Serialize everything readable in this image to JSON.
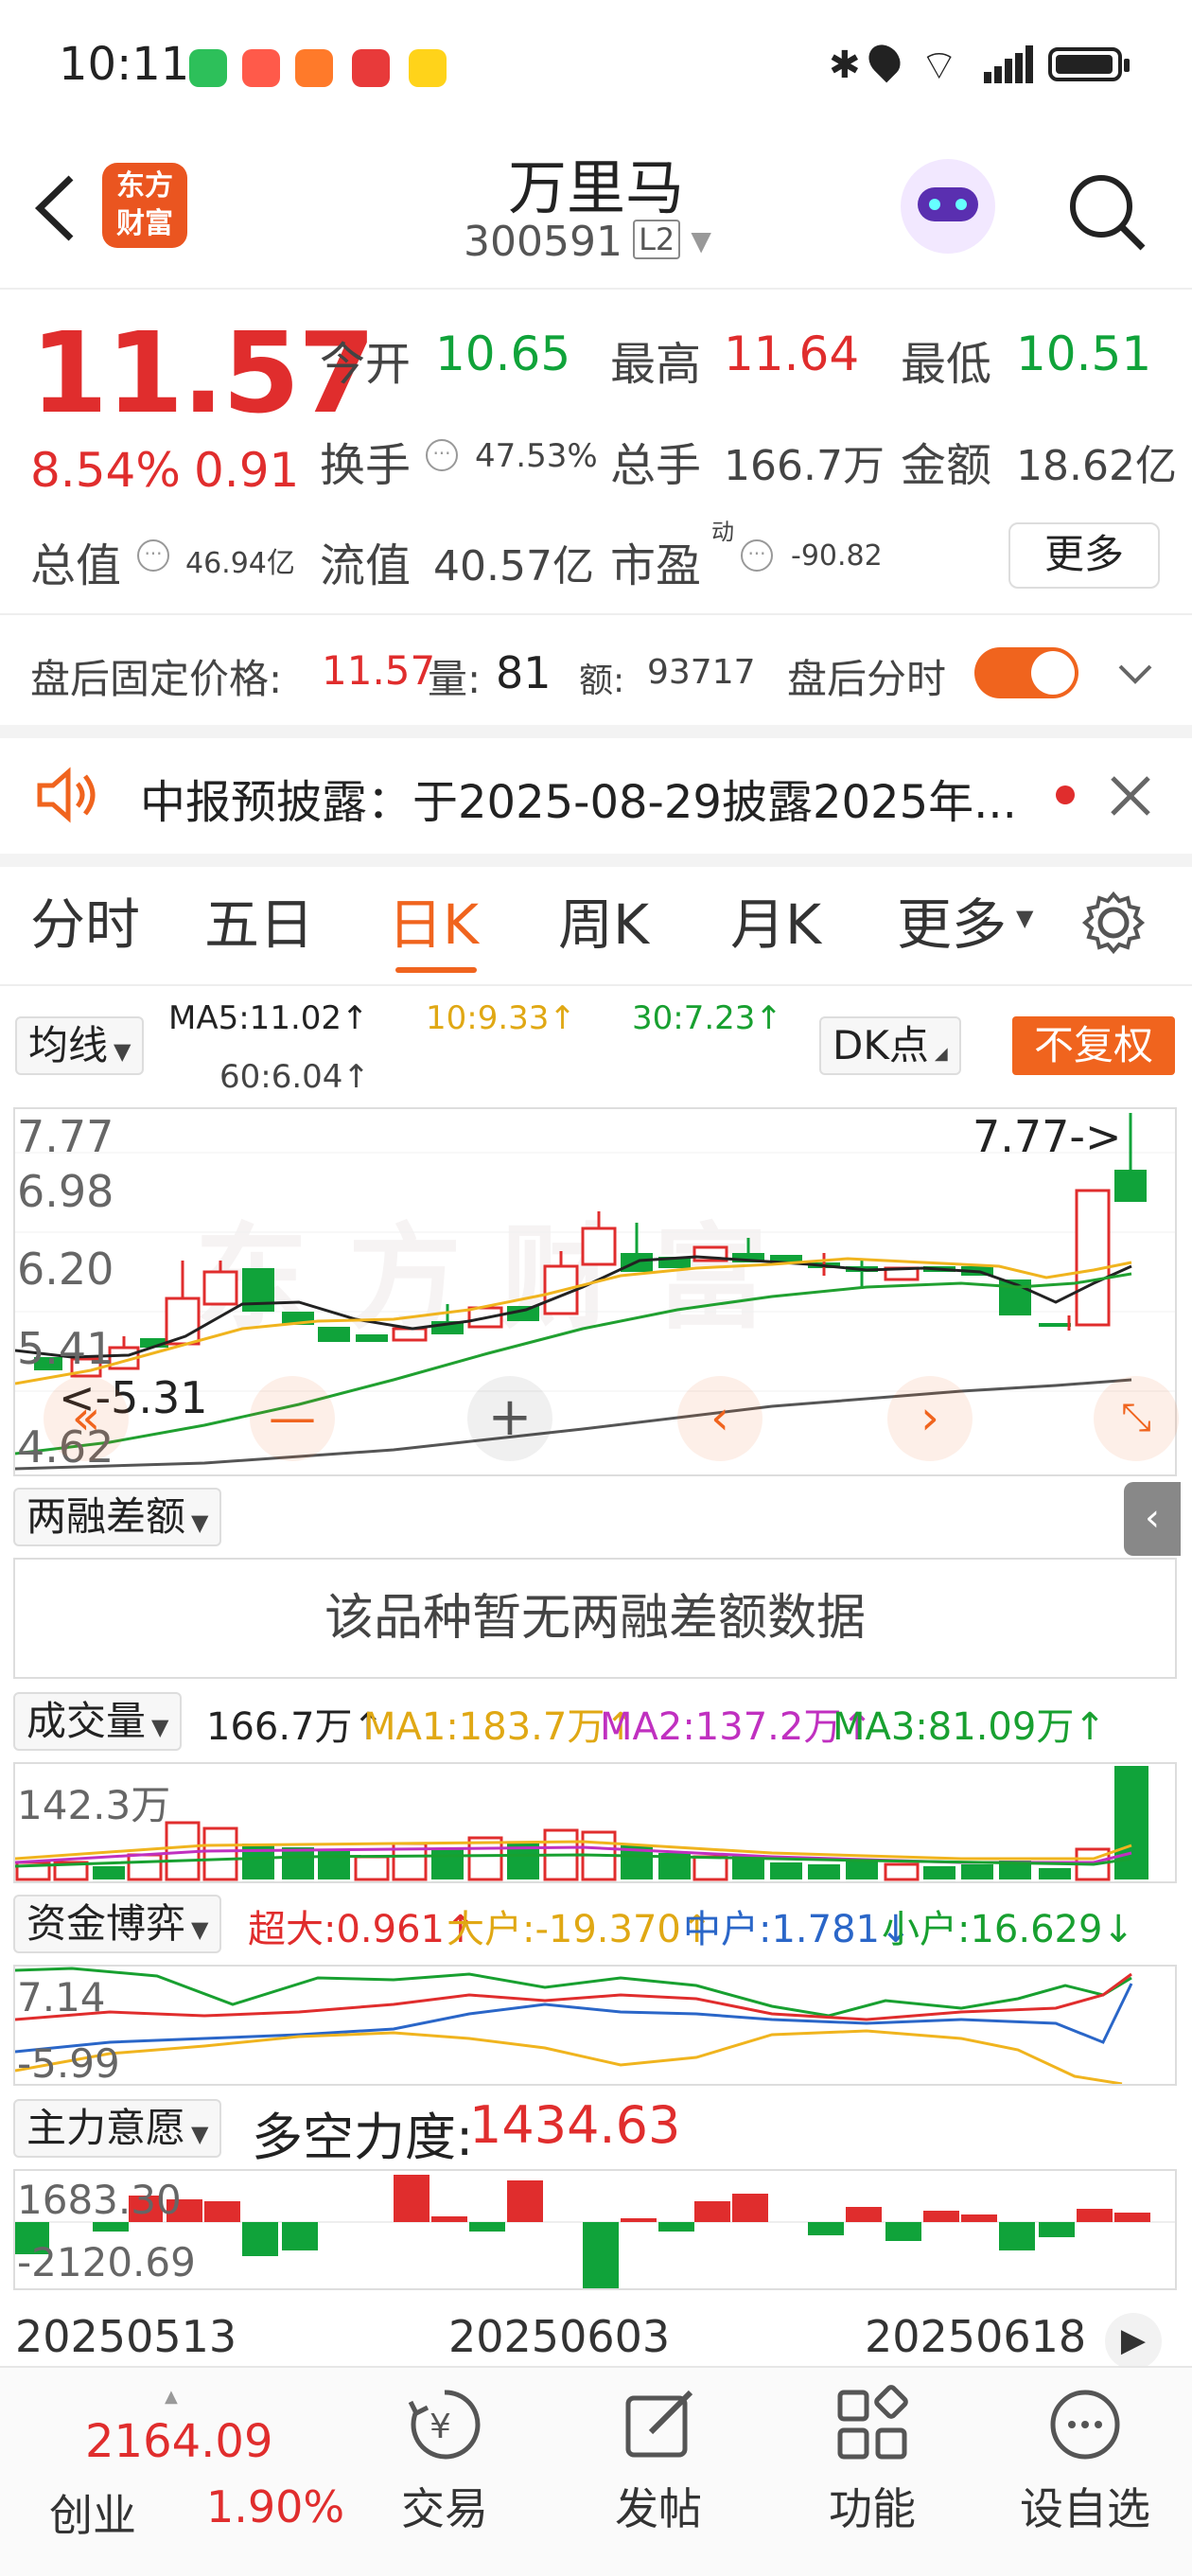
{
  "status_bar": {
    "time": "10:11",
    "battery": "⬛"
  },
  "header": {
    "title": "万里马",
    "code": "300591",
    "level_badge": "L2",
    "logo_line1": "东方",
    "logo_line2": "财富"
  },
  "quote": {
    "price": "11.57",
    "change_pct": "8.54%",
    "change_amt": "0.91",
    "open_label": "今开",
    "open": "10.65",
    "high_label": "最高",
    "high": "11.64",
    "low_label": "最低",
    "low": "10.51",
    "turnover_label": "换手",
    "turnover": "47.53%",
    "volume_label": "总手",
    "volume": "166.7万",
    "amount_label": "金额",
    "amount": "18.62亿",
    "mktcap_label": "总值",
    "mktcap": "46.94亿",
    "float_label": "流值",
    "float": "40.57亿",
    "pe_label": "市盈",
    "pe_sup": "动",
    "pe": "-90.82",
    "more": "更多"
  },
  "after_hours": {
    "label": "盘后固定价格:",
    "price": "11.57",
    "vol_label": "量:",
    "vol": "81",
    "amt_label": "额:",
    "amt": "93717",
    "toggle_label": "盘后分时"
  },
  "notice": {
    "text": "中报预披露：于2025-08-29披露2025年..."
  },
  "tabs": [
    "分时",
    "五日",
    "日K",
    "周K",
    "月K",
    "更多"
  ],
  "active_tab": 2,
  "ma_bar": {
    "selector": "均线",
    "ma5": "MA5:11.02↑",
    "ma10": "10:9.33↑",
    "ma30": "30:7.23↑",
    "ma60": "60:6.04↑",
    "dk": "DK点",
    "adjust": "不复权"
  },
  "kline": {
    "y_labels": [
      "7.77",
      "6.98",
      "6.20",
      "5.41",
      "4.62"
    ],
    "max_tag": "7.77->",
    "min_tag": "<-5.31"
  },
  "margin": {
    "selector": "两融差额",
    "empty_text": "该品种暂无两融差额数据"
  },
  "volume_bar": {
    "selector": "成交量",
    "vol": "166.7万↑",
    "ma1": "MA1:183.7万↑",
    "ma2": "MA2:137.2万↑",
    "ma3": "MA3:81.09万↑",
    "y_label": "142.3万"
  },
  "fund": {
    "selector": "资金博弈",
    "super": "超大:0.961↑",
    "large": "大户:-19.370↑",
    "mid": "中户:1.781↓",
    "small": "小户:16.629↓",
    "y_top": "7.14",
    "y_bottom": "-5.99"
  },
  "force": {
    "selector": "主力意愿",
    "label": "多空力度:",
    "value": "1434.63",
    "y_top": "1683.30",
    "y_bottom": "-2120.69"
  },
  "dates": [
    "20250513",
    "20250603",
    "20250618"
  ],
  "bottom_nav": {
    "index_value": "2164.09",
    "index_name": "创业",
    "index_pct": "1.90%",
    "trade": "交易",
    "post": "发帖",
    "func": "功能",
    "watch": "设自选"
  },
  "colors": {
    "up": "#e02d2d",
    "down": "#10a33a",
    "accent": "#f0641e",
    "ma5": "#222222",
    "ma10": "#f0b41e",
    "ma30": "#20a030",
    "ma60": "#555555"
  }
}
